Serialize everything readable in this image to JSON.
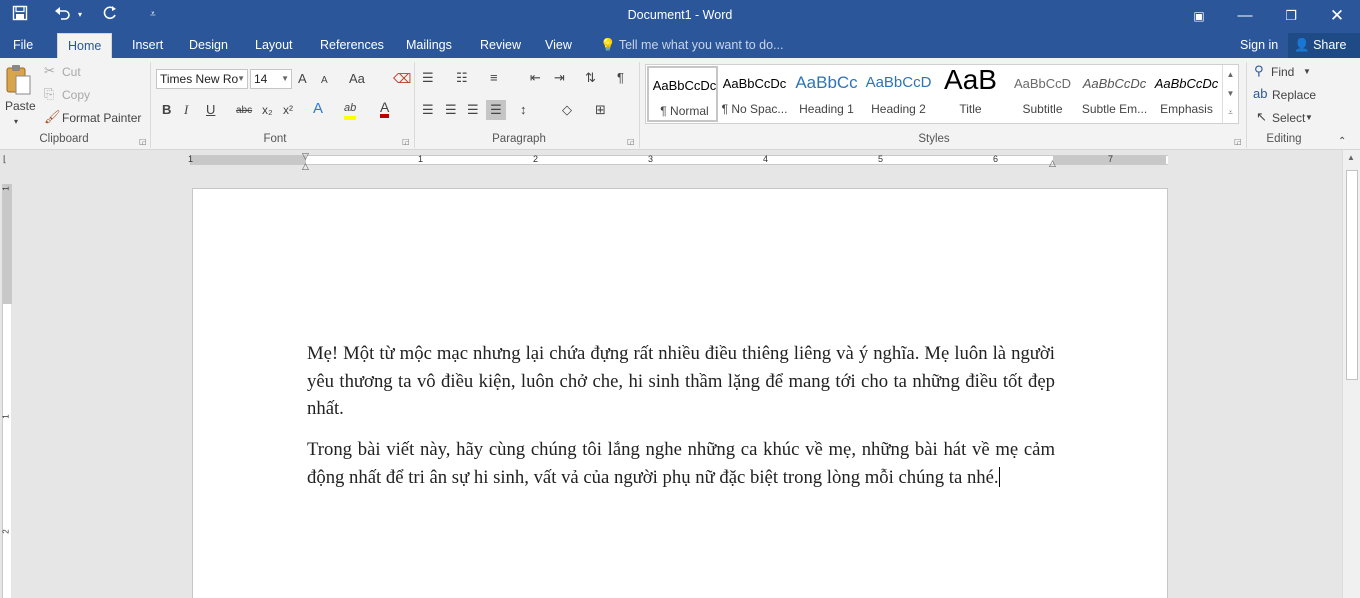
{
  "titlebar": {
    "title": "Document1 - Word",
    "quick_access": {
      "save_icon": "save-icon",
      "undo_icon": "undo-icon",
      "redo_icon": "redo-icon",
      "customize_icon": "customize-icon"
    },
    "window_controls": {
      "ribbon_display": "ribbon-display-icon",
      "minimize": "minimize-icon",
      "restore": "restore-icon",
      "close": "close-icon"
    }
  },
  "tabs": [
    {
      "label": "File"
    },
    {
      "label": "Home"
    },
    {
      "label": "Insert"
    },
    {
      "label": "Design"
    },
    {
      "label": "Layout"
    },
    {
      "label": "References"
    },
    {
      "label": "Mailings"
    },
    {
      "label": "Review"
    },
    {
      "label": "View"
    }
  ],
  "active_tab": "Home",
  "tell_me": {
    "placeholder": "Tell me what you want to do..."
  },
  "account": {
    "sign_in": "Sign in",
    "share": "Share"
  },
  "clipboard": {
    "paste": "Paste",
    "cut": "Cut",
    "copy": "Copy",
    "format_painter": "Format Painter",
    "group_label": "Clipboard"
  },
  "font": {
    "family": "Times New Ro",
    "size": "14",
    "group_label": "Font",
    "grow": "A",
    "shrink": "A",
    "case": "Aa",
    "bold": "B",
    "italic": "I",
    "underline": "U",
    "strike": "abc",
    "subscript": "x₂",
    "superscript": "x²",
    "text_effects": "A",
    "highlight": "ab",
    "font_color": "A",
    "font_color_hex": "#c00000",
    "highlight_hex": "#ffff00"
  },
  "paragraph": {
    "group_label": "Paragraph",
    "pilcrow": "¶"
  },
  "styles": {
    "group_label": "Styles",
    "items": [
      {
        "preview": "AaBbCcDc",
        "name": "¶ Normal"
      },
      {
        "preview": "AaBbCcDc",
        "name": "¶ No Spac..."
      },
      {
        "preview": "AaBbCc",
        "name": "Heading 1"
      },
      {
        "preview": "AaBbCcD",
        "name": "Heading 2"
      },
      {
        "preview": "AaB",
        "name": "Title"
      },
      {
        "preview": "AaBbCcD",
        "name": "Subtitle"
      },
      {
        "preview": "AaBbCcDc",
        "name": "Subtle Em..."
      },
      {
        "preview": "AaBbCcDc",
        "name": "Emphasis"
      }
    ]
  },
  "editing": {
    "find": "Find",
    "replace": "Replace",
    "select": "Select",
    "group_label": "Editing"
  },
  "ruler": {
    "numbers": [
      "1",
      "1",
      "2",
      "3",
      "4",
      "5",
      "6",
      "7"
    ]
  },
  "vruler": {
    "numbers": [
      "1",
      "1",
      "2"
    ]
  },
  "document": {
    "paragraphs": [
      "Mẹ! Một từ mộc mạc nhưng lại chứa đựng rất nhiều điều thiêng liêng và ý nghĩa. Mẹ luôn là người yêu thương ta vô điều kiện, luôn chở che, hi sinh thầm lặng để mang tới cho ta những điều tốt đẹp nhất.",
      "Trong bài viết này, hãy cùng chúng tôi lắng nghe những ca khúc về mẹ, những bài hát về mẹ cảm động nhất để tri ân sự hi sinh, vất vả của người phụ nữ đặc biệt trong lòng mỗi chúng ta nhé."
    ]
  },
  "colors": {
    "brand": "#2b579a",
    "ribbon_bg": "#f3f3f3",
    "canvas_bg": "#e6e6e6"
  }
}
